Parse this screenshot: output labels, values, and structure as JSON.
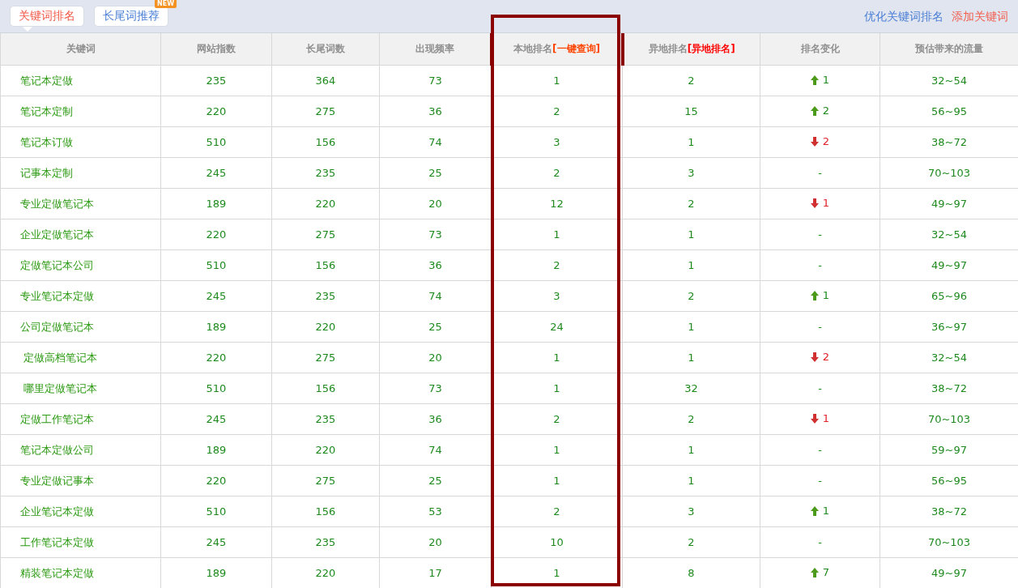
{
  "tabs": [
    {
      "label": "关键词排名",
      "selected": true
    },
    {
      "label": "长尾词推荐",
      "selected": false,
      "badge": "NEW"
    }
  ],
  "actions": [
    {
      "label": "优化关键词排名",
      "kind": "primary"
    },
    {
      "label": "添加关键词",
      "kind": "danger"
    }
  ],
  "columns": [
    {
      "label": "关键词",
      "highlighted": false
    },
    {
      "label": "网站指数",
      "highlighted": false
    },
    {
      "label": "长尾词数",
      "highlighted": false
    },
    {
      "label": "出现频率",
      "highlighted": false
    },
    {
      "label": "本地排名",
      "link": "[一键查询]",
      "color": "#ff4400",
      "highlighted": true
    },
    {
      "label": "异地排名",
      "link": "[异地排名]",
      "color": "#ff0000",
      "highlighted": false
    },
    {
      "label": "排名变化",
      "highlighted": false
    },
    {
      "label": "预估带来的流量",
      "highlighted": false
    }
  ],
  "rows": [
    {
      "keyword": "笔记本定做",
      "index": "235",
      "longtail": "364",
      "frequency": "73",
      "local": "1",
      "remote": "2",
      "change": {
        "kind": "up",
        "value": "1"
      },
      "traffic": "32~54"
    },
    {
      "keyword": "笔记本定制",
      "index": "220",
      "longtail": "275",
      "frequency": "36",
      "local": "2",
      "remote": "15",
      "change": {
        "kind": "up",
        "value": "2"
      },
      "traffic": "56~95"
    },
    {
      "keyword": "笔记本订做",
      "index": "510",
      "longtail": "156",
      "frequency": "74",
      "local": "3",
      "remote": "1",
      "change": {
        "kind": "down",
        "value": "2"
      },
      "traffic": "38~72"
    },
    {
      "keyword": "记事本定制",
      "index": "245",
      "longtail": "235",
      "frequency": "25",
      "local": "2",
      "remote": "3",
      "change": {
        "kind": "none",
        "value": "-"
      },
      "traffic": "70~103"
    },
    {
      "keyword": "专业定做笔记本",
      "index": "189",
      "longtail": "220",
      "frequency": "20",
      "local": "12",
      "remote": "2",
      "change": {
        "kind": "down",
        "value": "1"
      },
      "traffic": "49~97"
    },
    {
      "keyword": "企业定做笔记本",
      "index": "220",
      "longtail": "275",
      "frequency": "73",
      "local": "1",
      "remote": "1",
      "change": {
        "kind": "none",
        "value": "-"
      },
      "traffic": "32~54"
    },
    {
      "keyword": "定做笔记本公司",
      "index": "510",
      "longtail": "156",
      "frequency": "36",
      "local": "2",
      "remote": "1",
      "change": {
        "kind": "none",
        "value": "-"
      },
      "traffic": "49~97"
    },
    {
      "keyword": "专业笔记本定做",
      "index": "245",
      "longtail": "235",
      "frequency": "74",
      "local": "3",
      "remote": "2",
      "change": {
        "kind": "up",
        "value": "1"
      },
      "traffic": "65~96"
    },
    {
      "keyword": "公司定做笔记本",
      "index": "189",
      "longtail": "220",
      "frequency": "25",
      "local": "24",
      "remote": "1",
      "change": {
        "kind": "none",
        "value": "-"
      },
      "traffic": "36~97"
    },
    {
      "keyword": " 定做高档笔记本",
      "index": "220",
      "longtail": "275",
      "frequency": "20",
      "local": "1",
      "remote": "1",
      "change": {
        "kind": "down",
        "value": "2"
      },
      "traffic": "32~54"
    },
    {
      "keyword": " 哪里定做笔记本",
      "index": "510",
      "longtail": "156",
      "frequency": "73",
      "local": "1",
      "remote": "32",
      "change": {
        "kind": "none",
        "value": "-"
      },
      "traffic": "38~72"
    },
    {
      "keyword": "定做工作笔记本",
      "index": "245",
      "longtail": "235",
      "frequency": "36",
      "local": "2",
      "remote": "2",
      "change": {
        "kind": "down",
        "value": "1"
      },
      "traffic": "70~103"
    },
    {
      "keyword": "笔记本定做公司",
      "index": "189",
      "longtail": "220",
      "frequency": "74",
      "local": "1",
      "remote": "1",
      "change": {
        "kind": "none",
        "value": "-"
      },
      "traffic": "59~97"
    },
    {
      "keyword": "专业定做记事本",
      "index": "220",
      "longtail": "275",
      "frequency": "25",
      "local": "1",
      "remote": "1",
      "change": {
        "kind": "none",
        "value": "-"
      },
      "traffic": "56~95"
    },
    {
      "keyword": "企业笔记本定做",
      "index": "510",
      "longtail": "156",
      "frequency": "53",
      "local": "2",
      "remote": "3",
      "change": {
        "kind": "up",
        "value": "1"
      },
      "traffic": "38~72"
    },
    {
      "keyword": "工作笔记本定做",
      "index": "245",
      "longtail": "235",
      "frequency": "20",
      "local": "10",
      "remote": "2",
      "change": {
        "kind": "none",
        "value": "-"
      },
      "traffic": "70~103"
    },
    {
      "keyword": "精装笔记本定做",
      "index": "189",
      "longtail": "220",
      "frequency": "17",
      "local": "1",
      "remote": "8",
      "change": {
        "kind": "up",
        "value": "7"
      },
      "traffic": "49~97"
    }
  ]
}
